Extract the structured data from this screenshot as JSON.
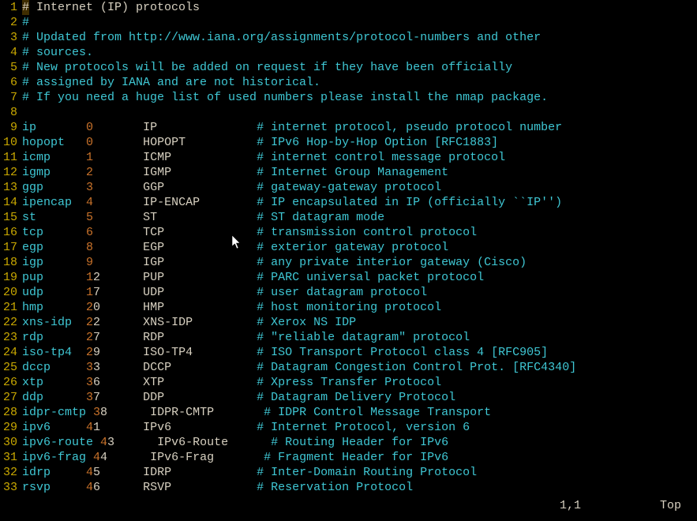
{
  "header": {
    "line1": " Internet (IP) protocols",
    "line2": "",
    "line3": " Updated from http://www.iana.org/assignments/protocol-numbers and other",
    "line4": " sources.",
    "line5": " New protocols will be added on request if they have been officially",
    "line6": " assigned by IANA and are not historical.",
    "line7": " If you need a huge list of used numbers please install the nmap package."
  },
  "cols": {
    "c0": 9,
    "c1": 8,
    "c2": 16,
    "c3": 3
  },
  "protocols": [
    {
      "ln": 9,
      "name": "ip",
      "num": "0",
      "alias": "IP",
      "desc": "internet protocol, pseudo protocol number"
    },
    {
      "ln": 10,
      "name": "hopopt",
      "num": "0",
      "alias": "HOPOPT",
      "desc": "IPv6 Hop-by-Hop Option [RFC1883]"
    },
    {
      "ln": 11,
      "name": "icmp",
      "num": "1",
      "alias": "ICMP",
      "desc": "internet control message protocol"
    },
    {
      "ln": 12,
      "name": "igmp",
      "num": "2",
      "alias": "IGMP",
      "desc": "Internet Group Management"
    },
    {
      "ln": 13,
      "name": "ggp",
      "num": "3",
      "alias": "GGP",
      "desc": "gateway-gateway protocol"
    },
    {
      "ln": 14,
      "name": "ipencap",
      "num": "4",
      "alias": "IP-ENCAP",
      "desc": "IP encapsulated in IP (officially ``IP'')"
    },
    {
      "ln": 15,
      "name": "st",
      "num": "5",
      "alias": "ST",
      "desc": "ST datagram mode"
    },
    {
      "ln": 16,
      "name": "tcp",
      "num": "6",
      "alias": "TCP",
      "desc": "transmission control protocol"
    },
    {
      "ln": 17,
      "name": "egp",
      "num": "8",
      "alias": "EGP",
      "desc": "exterior gateway protocol"
    },
    {
      "ln": 18,
      "name": "igp",
      "num": "9",
      "alias": "IGP",
      "desc": "any private interior gateway (Cisco)"
    },
    {
      "ln": 19,
      "name": "pup",
      "num": "12",
      "alias": "PUP",
      "desc": "PARC universal packet protocol"
    },
    {
      "ln": 20,
      "name": "udp",
      "num": "17",
      "alias": "UDP",
      "desc": "user datagram protocol"
    },
    {
      "ln": 21,
      "name": "hmp",
      "num": "20",
      "alias": "HMP",
      "desc": "host monitoring protocol"
    },
    {
      "ln": 22,
      "name": "xns-idp",
      "num": "22",
      "alias": "XNS-IDP",
      "desc": "Xerox NS IDP"
    },
    {
      "ln": 23,
      "name": "rdp",
      "num": "27",
      "alias": "RDP",
      "desc": "\"reliable datagram\" protocol"
    },
    {
      "ln": 24,
      "name": "iso-tp4",
      "num": "29",
      "alias": "ISO-TP4",
      "desc": "ISO Transport Protocol class 4 [RFC905]"
    },
    {
      "ln": 25,
      "name": "dccp",
      "num": "33",
      "alias": "DCCP",
      "desc": "Datagram Congestion Control Prot. [RFC4340]"
    },
    {
      "ln": 26,
      "name": "xtp",
      "num": "36",
      "alias": "XTP",
      "desc": "Xpress Transfer Protocol"
    },
    {
      "ln": 27,
      "name": "ddp",
      "num": "37",
      "alias": "DDP",
      "desc": "Datagram Delivery Protocol"
    },
    {
      "ln": 28,
      "name": "idpr-cmtp",
      "num": "38",
      "alias": "IDPR-CMTP",
      "desc": "IDPR Control Message Transport"
    },
    {
      "ln": 29,
      "name": "ipv6",
      "num": "41",
      "alias": "IPv6",
      "desc": "Internet Protocol, version 6"
    },
    {
      "ln": 30,
      "name": "ipv6-route",
      "num": "43",
      "alias": "IPv6-Route",
      "desc": "Routing Header for IPv6"
    },
    {
      "ln": 31,
      "name": "ipv6-frag",
      "num": "44",
      "alias": "IPv6-Frag",
      "desc": "Fragment Header for IPv6"
    },
    {
      "ln": 32,
      "name": "idrp",
      "num": "45",
      "alias": "IDRP",
      "desc": "Inter-Domain Routing Protocol"
    },
    {
      "ln": 33,
      "name": "rsvp",
      "num": "46",
      "alias": "RSVP",
      "desc": "Reservation Protocol"
    }
  ],
  "status": {
    "position": "1,1",
    "scroll": "Top"
  }
}
